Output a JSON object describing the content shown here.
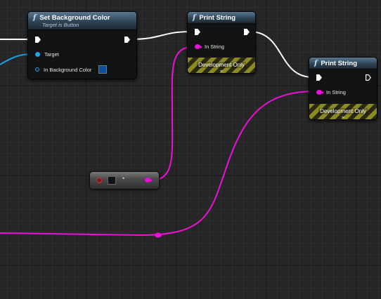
{
  "colors": {
    "exec_wire": "#ffffff",
    "string_wire": "#ee0fd9",
    "object_wire": "#1aa0e0",
    "header": "#2e4456",
    "background_color_value": "#0c4f9b"
  },
  "nodes": {
    "set_bg": {
      "icon": "function-icon",
      "title": "Set Background Color",
      "subtitle": "Target is Button",
      "pin_target": "Target",
      "pin_color": "In Background Color"
    },
    "print1": {
      "icon": "function-icon",
      "title": "Print String",
      "pin_string": "In String",
      "dev_label": "Development Only"
    },
    "print2": {
      "icon": "function-icon",
      "title": "Print String",
      "pin_string": "In String",
      "dev_label": "Development Only"
    }
  },
  "converter": {
    "icon": "conversion-node-icon",
    "dot": "•"
  },
  "glyphs": {
    "fn": "f",
    "chevron": "⌄"
  }
}
